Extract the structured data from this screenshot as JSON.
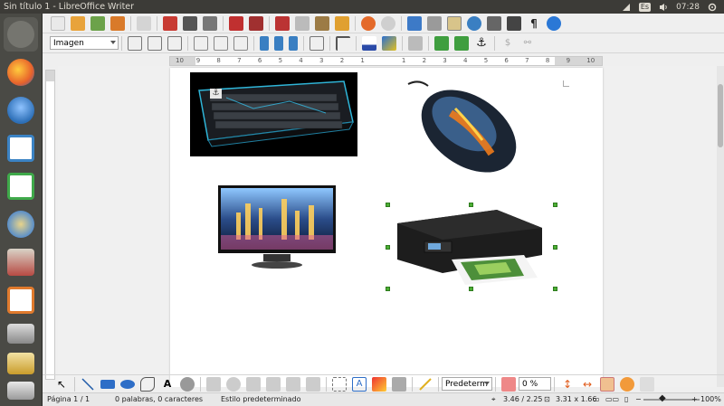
{
  "window": {
    "title": "Sin título 1 - LibreOffice Writer"
  },
  "tray": {
    "keyboard": "Es",
    "time": "07:28"
  },
  "launcher": {
    "items": [
      {
        "name": "dash-home-icon",
        "color": "#6b6b66"
      },
      {
        "name": "firefox-icon",
        "color": "#e8632b"
      },
      {
        "name": "thunderbird-icon",
        "color": "#2d6fb7"
      },
      {
        "name": "libreoffice-writer-icon",
        "color": "#3b83c4"
      },
      {
        "name": "libreoffice-calc-icon",
        "color": "#3fa94a"
      },
      {
        "name": "system-settings-icon",
        "color": "#5a8fc9"
      },
      {
        "name": "files-icon",
        "color": "#b74a43"
      },
      {
        "name": "libreoffice-impress-icon",
        "color": "#e07a2d"
      },
      {
        "name": "screenshot-icon",
        "color": "#888"
      },
      {
        "name": "image-viewer-icon",
        "color": "#c99c2b"
      },
      {
        "name": "trash-icon",
        "color": "#777"
      }
    ]
  },
  "formatting": {
    "style_combo": "Imagen"
  },
  "ruler": {
    "labels": [
      "10",
      "9",
      "8",
      "7",
      "6",
      "5",
      "4",
      "3",
      "2",
      "1",
      "",
      "1",
      "2",
      "3",
      "4",
      "5",
      "6",
      "7",
      "8",
      "9",
      "10"
    ]
  },
  "drawing": {
    "fill_combo": "Predeterm",
    "transparency": "0 %"
  },
  "status": {
    "page": "Página 1 / 1",
    "words": "0 palabras, 0 caracteres",
    "style": "Estilo predeterminado",
    "position": "3.46 / 2.25",
    "size": "3.31 x 1.66",
    "zoom": "100%"
  },
  "page_images": [
    {
      "name": "keyboard-image",
      "desc": "keyboard"
    },
    {
      "name": "mouse-image",
      "desc": "mouse"
    },
    {
      "name": "monitor-image",
      "desc": "monitor"
    },
    {
      "name": "printer-image",
      "desc": "printer"
    }
  ]
}
